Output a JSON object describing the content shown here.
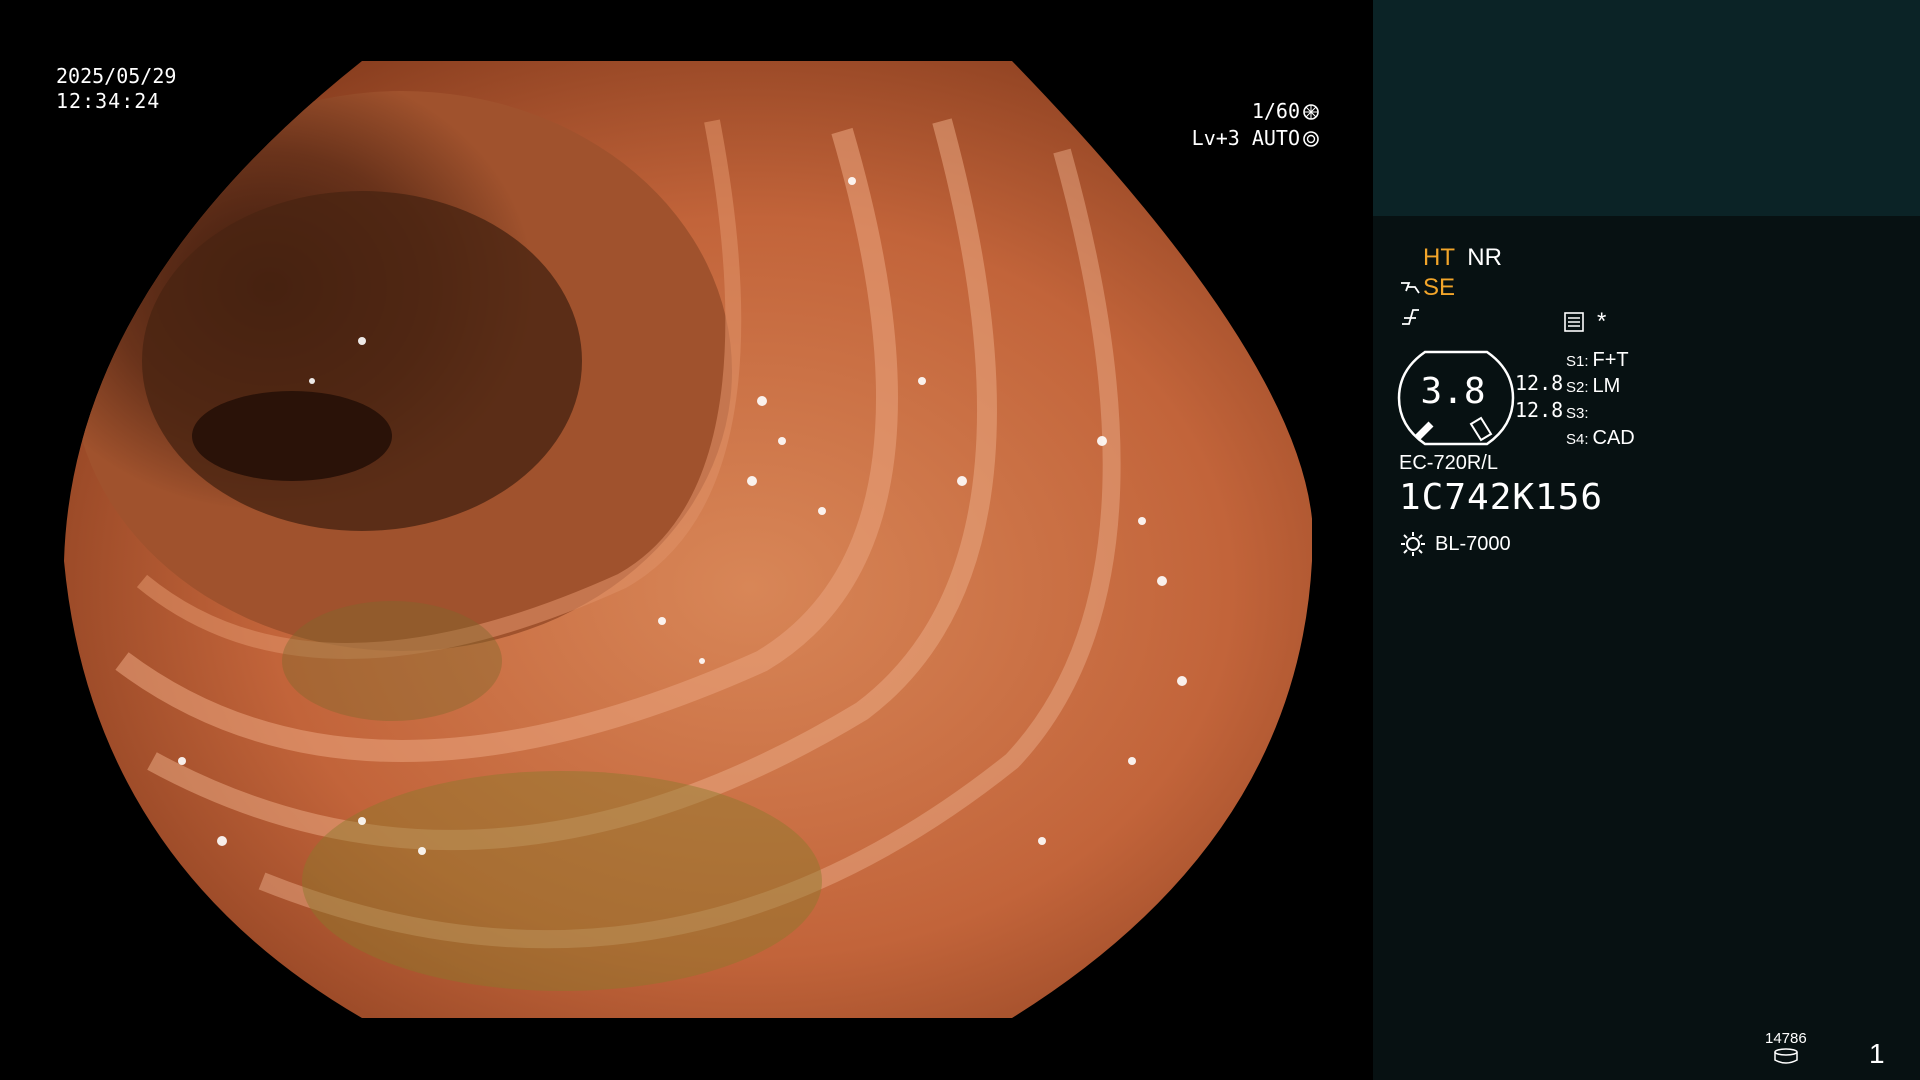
{
  "overlay": {
    "date": "2025/05/29",
    "time": "12:34:24",
    "shutter": "1/60",
    "level": "Lv+3",
    "mode": "AUTO"
  },
  "panel": {
    "ht": "HT",
    "nr": "NR",
    "se": "SE",
    "asterisk": "*",
    "gauge_value": "3.8",
    "side_values": [
      "12.8",
      "12.8"
    ],
    "switches": [
      {
        "key": "S1:",
        "value": "F+T"
      },
      {
        "key": "S2:",
        "value": "LM"
      },
      {
        "key": "S3:",
        "value": ""
      },
      {
        "key": "S4:",
        "value": "CAD"
      }
    ],
    "scope_model": "EC-720R/L",
    "scope_serial": "1C742K156",
    "light_source": "BL-7000",
    "counter": "14786",
    "page": "1"
  },
  "colors": {
    "panel_bg": "#071112",
    "panel_top_bg": "#0b2326",
    "accent_orange": "#f2a52a"
  }
}
